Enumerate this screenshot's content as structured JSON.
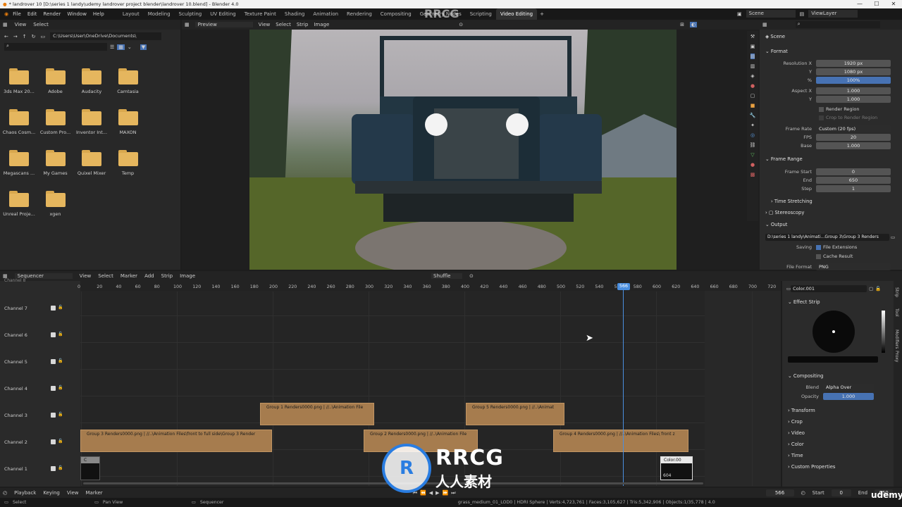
{
  "window": {
    "title": "* landrover 10 [D:\\series 1 landy\\udemy landrover project blender\\landrover 10.blend] - Blender 4.0"
  },
  "menu": [
    "File",
    "Edit",
    "Render",
    "Window",
    "Help"
  ],
  "workspaces": [
    "Layout",
    "Modeling",
    "Sculpting",
    "UV Editing",
    "Texture Paint",
    "Shading",
    "Animation",
    "Rendering",
    "Compositing",
    "Geometry Nodes",
    "Scripting",
    "Video Editing"
  ],
  "scene": {
    "label": "Scene",
    "view_layer": "ViewLayer"
  },
  "file_browser": {
    "menus": [
      "View",
      "Select"
    ],
    "path": "C:\\Users\\User\\OneDrive\\Documents\\",
    "folders": [
      "3ds Max 20...",
      "Adobe",
      "Audacity",
      "Camtasia",
      "Chaos Cosm...",
      "Custom Pro...",
      "Inventor Int...",
      "MAXON",
      "Megascans ...",
      "My Games",
      "Quixel Mixer",
      "Temp",
      "Unreal Proje...",
      "xgen"
    ]
  },
  "preview": {
    "mode": "Preview",
    "menus": [
      "View",
      "Select",
      "Strip",
      "Image"
    ]
  },
  "properties": {
    "scene_label": "Scene",
    "format_label": "Format",
    "res_x_label": "Resolution X",
    "res_x": "1920 px",
    "res_y_label": "Y",
    "res_y": "1080 px",
    "pct_label": "%",
    "pct": "100%",
    "aspect_x_label": "Aspect X",
    "aspect_x": "1.000",
    "aspect_y_label": "Y",
    "aspect_y": "1.000",
    "render_region": "Render Region",
    "crop_region": "Crop to Render Region",
    "frame_rate_label": "Frame Rate",
    "frame_rate": "Custom (20 fps)",
    "fps_label": "FPS",
    "fps": "20",
    "base_label": "Base",
    "base": "1.000",
    "frame_range_label": "Frame Range",
    "frame_start_label": "Frame Start",
    "frame_start": "0",
    "end_label": "End",
    "end": "650",
    "step_label": "Step",
    "step": "1",
    "time_stretching": "Time Stretching",
    "stereoscopy": "Stereoscopy",
    "output_label": "Output",
    "output_path": "D:\\series 1 landy\\Animati...Group 3\\Group 3 Renders",
    "saving_label": "Saving",
    "file_ext": "File Extensions",
    "cache_result": "Cache Result",
    "file_format_label": "File Format",
    "file_format": "PNG"
  },
  "sequencer": {
    "editor": "Sequencer",
    "menus": [
      "View",
      "Select",
      "Marker",
      "Add",
      "Strip",
      "Image"
    ],
    "shuffle": "Shuffle",
    "ticks": [
      "0",
      "20",
      "40",
      "60",
      "80",
      "100",
      "120",
      "140",
      "160",
      "180",
      "200",
      "220",
      "240",
      "260",
      "280",
      "300",
      "320",
      "340",
      "360",
      "380",
      "400",
      "420",
      "440",
      "460",
      "480",
      "500",
      "520",
      "540",
      "560",
      "580",
      "600",
      "620",
      "640",
      "660",
      "680",
      "700",
      "720"
    ],
    "current_frame": "566",
    "channels": [
      "Channel 7",
      "Channel 6",
      "Channel 5",
      "Channel 4",
      "Channel 3",
      "Channel 2",
      "Channel 1"
    ],
    "channel_top": "Channel 8",
    "strips": [
      {
        "label": "Group 1 Renders0000.png | //..\\Animation File"
      },
      {
        "label": "Group 5 Renders0000.png | //..\\Animat"
      },
      {
        "label": "Group 3 Renders0000.png | //..\\Animation Files\\front to full side\\Group 3 Render"
      },
      {
        "label": "Group 2 Renders0000.png | //..\\Animation File"
      },
      {
        "label": "Group 4 Renders0000.png | //..\\Animation Files\\ front z"
      }
    ],
    "color_strip_a": "C",
    "color_strip_b": "Color.00",
    "color_strip_b_len": "604"
  },
  "strip_panel": {
    "name": "Color.001",
    "effect_strip": "Effect Strip",
    "compositing": "Compositing",
    "blend_label": "Blend",
    "blend": "Alpha Over",
    "opacity_label": "Opacity",
    "opacity": "1.000",
    "sections": [
      "Transform",
      "Crop",
      "Video",
      "Color",
      "Time",
      "Custom Properties"
    ],
    "tabs": [
      "Strip",
      "Tool",
      "Modifiers",
      "Proxy"
    ]
  },
  "timeline": {
    "menus": [
      "Playback",
      "Keying",
      "View",
      "Marker"
    ],
    "frame": "566",
    "start_label": "Start",
    "start": "0",
    "end_label": "End",
    "end": "650"
  },
  "statusbar": {
    "select": "Select",
    "pan": "Pan View",
    "sequencer": "Sequencer",
    "stats": "grass_medium_01_LOD0 | HDRI Sphere | Verts:4,723,761 | Faces:3,105,627 | Tris:5,342,906 | Objects:1/35,778 | 4.0"
  },
  "watermark": {
    "brand": "RRCG",
    "sub": "人人素材",
    "udemy": "udemy"
  },
  "colors": {
    "accent": "#4772b3",
    "strip": "#a67c4e",
    "playhead": "#4a8fe0"
  }
}
